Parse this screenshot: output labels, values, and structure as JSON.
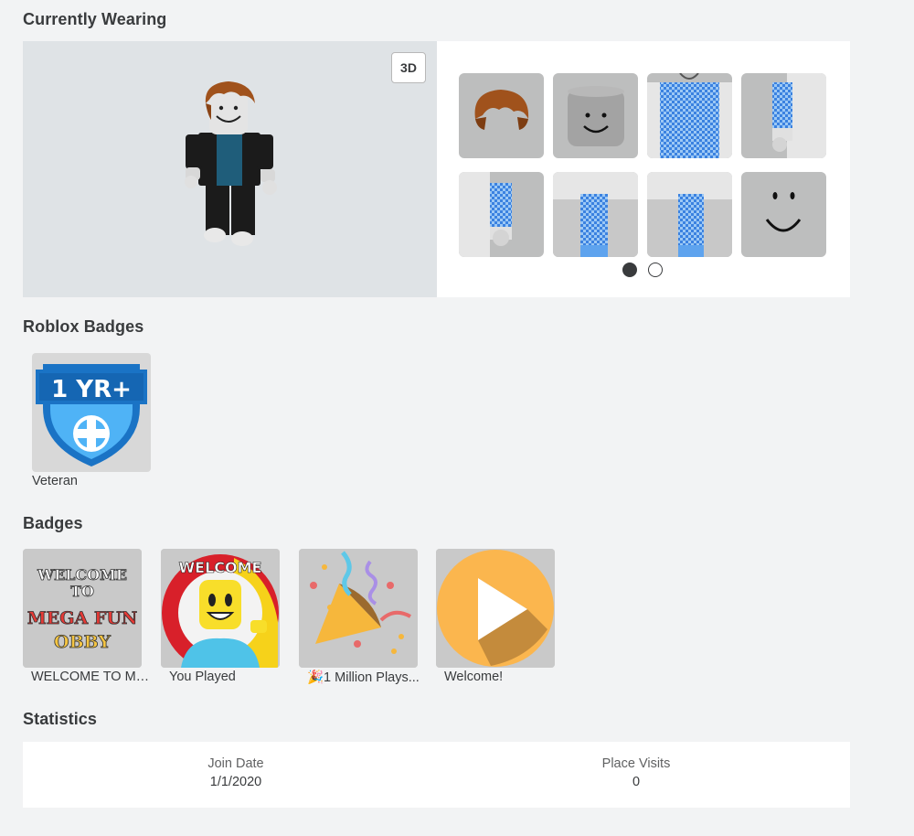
{
  "sections": {
    "currently_wearing": "Currently Wearing",
    "roblox_badges": "Roblox Badges",
    "badges": "Badges",
    "statistics": "Statistics"
  },
  "avatar": {
    "view_toggle_label": "3D",
    "item_icons": [
      "hair-icon",
      "head-icon",
      "shirt-icon",
      "right-arm-icon",
      "left-arm-icon",
      "right-leg-icon",
      "left-leg-icon",
      "face-icon"
    ],
    "page_count": 2,
    "active_page": 1
  },
  "roblox_badges": [
    {
      "name": "Veteran",
      "icon": "veteran-badge-icon",
      "emblem_text": "1 YR+"
    }
  ],
  "badges": [
    {
      "name": "WELCOME TO ME...",
      "icon": "mega-fun-obby-badge-icon",
      "art_text": [
        "WELCOME",
        "TO",
        "MEGA FUN",
        "OBBY"
      ]
    },
    {
      "name": "You Played",
      "icon": "you-played-badge-icon",
      "art_text": "WELCOME"
    },
    {
      "name": "🎉1 Million Plays...",
      "icon": "party-popper-badge-icon"
    },
    {
      "name": "Welcome!",
      "icon": "play-badge-icon"
    }
  ],
  "statistics": {
    "join_date_label": "Join Date",
    "join_date_value": "1/1/2020",
    "place_visits_label": "Place Visits",
    "place_visits_value": "0"
  }
}
